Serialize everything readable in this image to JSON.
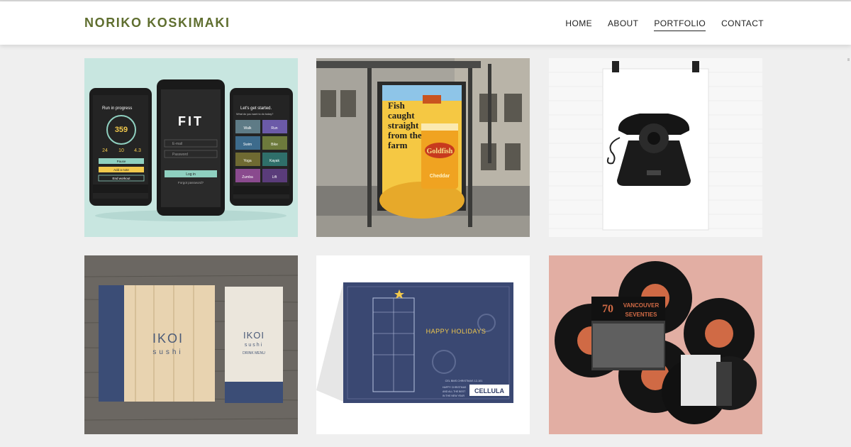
{
  "site": {
    "brand": "NORIKO KOSKIMAKI"
  },
  "nav": {
    "items": [
      {
        "label": "HOME",
        "active": false
      },
      {
        "label": "ABOUT",
        "active": false
      },
      {
        "label": "PORTFOLIO",
        "active": true
      },
      {
        "label": "CONTACT",
        "active": false
      }
    ]
  },
  "colors": {
    "brand": "#5f6e2f",
    "background": "#efefef",
    "header": "#ffffff"
  },
  "portfolio": {
    "fit_app": {
      "screen1_title": "Run in progress",
      "screen1_count": "359",
      "screen1_stats": [
        "24",
        "10",
        "4.3"
      ],
      "screen1_buttons": [
        "Pause",
        "Add a note",
        "End workout"
      ],
      "screen2_logo": "FIT",
      "screen2_fields": [
        "E-mail",
        "Password"
      ],
      "screen2_button": "Log in",
      "screen2_link": "Forgot password?",
      "screen3_title": "Let's get started.",
      "screen3_prompt": "What do you want to do today?",
      "screen3_activities": [
        "Walk",
        "Run",
        "Swim",
        "Bike",
        "Yoga",
        "Kayak",
        "Zumba",
        "Lift"
      ]
    },
    "goldfish": {
      "headline": [
        "Fish",
        "caught",
        "straight",
        "from the",
        "farm"
      ],
      "brand": "Goldfish",
      "flavor": "Cheddar"
    },
    "telephone": {},
    "ikoi": {
      "logo": "IKOI",
      "sub": "sushi",
      "menu": "DRINK MENU"
    },
    "holiday": {
      "greeting": "HAPPY HOLIDAYS",
      "code": "CEL BMS CHRISTMAS 12-101",
      "note": [
        "HAPPY CHRISTMAS",
        "AND ALL THE BEST",
        "IN THE NEW YEAR"
      ],
      "brand": "CELLULA"
    },
    "vinyl": {
      "title1": "VANCOUVER",
      "title2": "SEVENTIES",
      "number": "70"
    }
  }
}
